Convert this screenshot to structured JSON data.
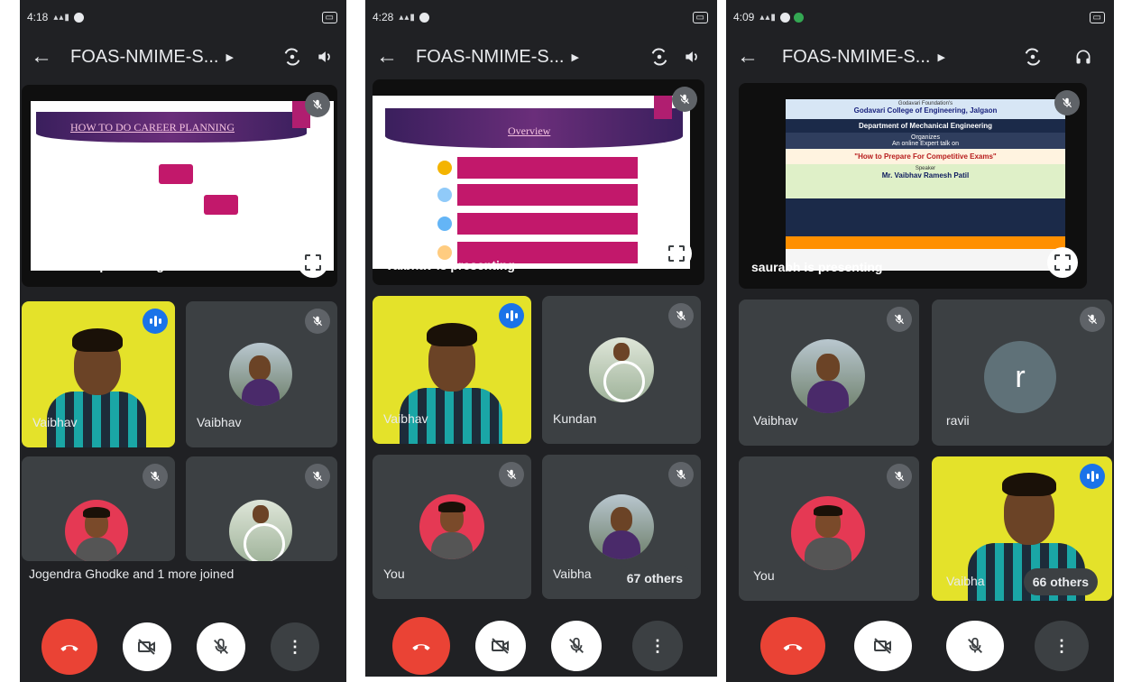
{
  "screens": [
    {
      "status_time": "4:18",
      "meeting_title": "FOAS-NMIME-S...",
      "slide_heading": "HOW TO DO CAREER PLANNING",
      "presenting_label": "Vaibhav is presenting",
      "tiles": [
        "Vaibhav",
        "Vaibhav"
      ],
      "notification": "Jogendra Ghodke and 1 more joined"
    },
    {
      "status_time": "4:28",
      "meeting_title": "FOAS-NMIME-S...",
      "slide_heading": "Overview",
      "presenting_label": "Vaibhav is presenting",
      "tiles": [
        "Vaibhav",
        "Kundan",
        "You",
        "Vaibha"
      ],
      "others": "67 others"
    },
    {
      "status_time": "4:09",
      "meeting_title": "FOAS-NMIME-S...",
      "presenting_label": "saurabh is presenting",
      "poster": {
        "line1": "Godavari Foundation's",
        "college": "Godavari College of Engineering, Jalgaon",
        "dept": "Department of Mechanical Engineering",
        "organizes": "Organizes",
        "talk": "An online Expert talk on",
        "topic": "\"How to Prepare For Competitive Exams\"",
        "speaker_label": "Speaker",
        "speaker": "Mr. Vaibhav Ramesh Patil"
      },
      "tiles": [
        "Vaibhav",
        "ravii",
        "You",
        "Vaibha"
      ],
      "avatar_letter": "r",
      "others": "66 others"
    }
  ],
  "colors": {
    "end_call": "#ea4335",
    "speaking": "#1a73e8",
    "background": "#202124",
    "tile": "#3c4043"
  },
  "icons": [
    "back-arrow-icon",
    "switch-camera-icon",
    "speaker-icon",
    "headphones-icon",
    "mic-off-icon",
    "speaking-indicator-icon",
    "fullscreen-icon",
    "end-call-icon",
    "camera-off-icon",
    "more-options-icon"
  ]
}
